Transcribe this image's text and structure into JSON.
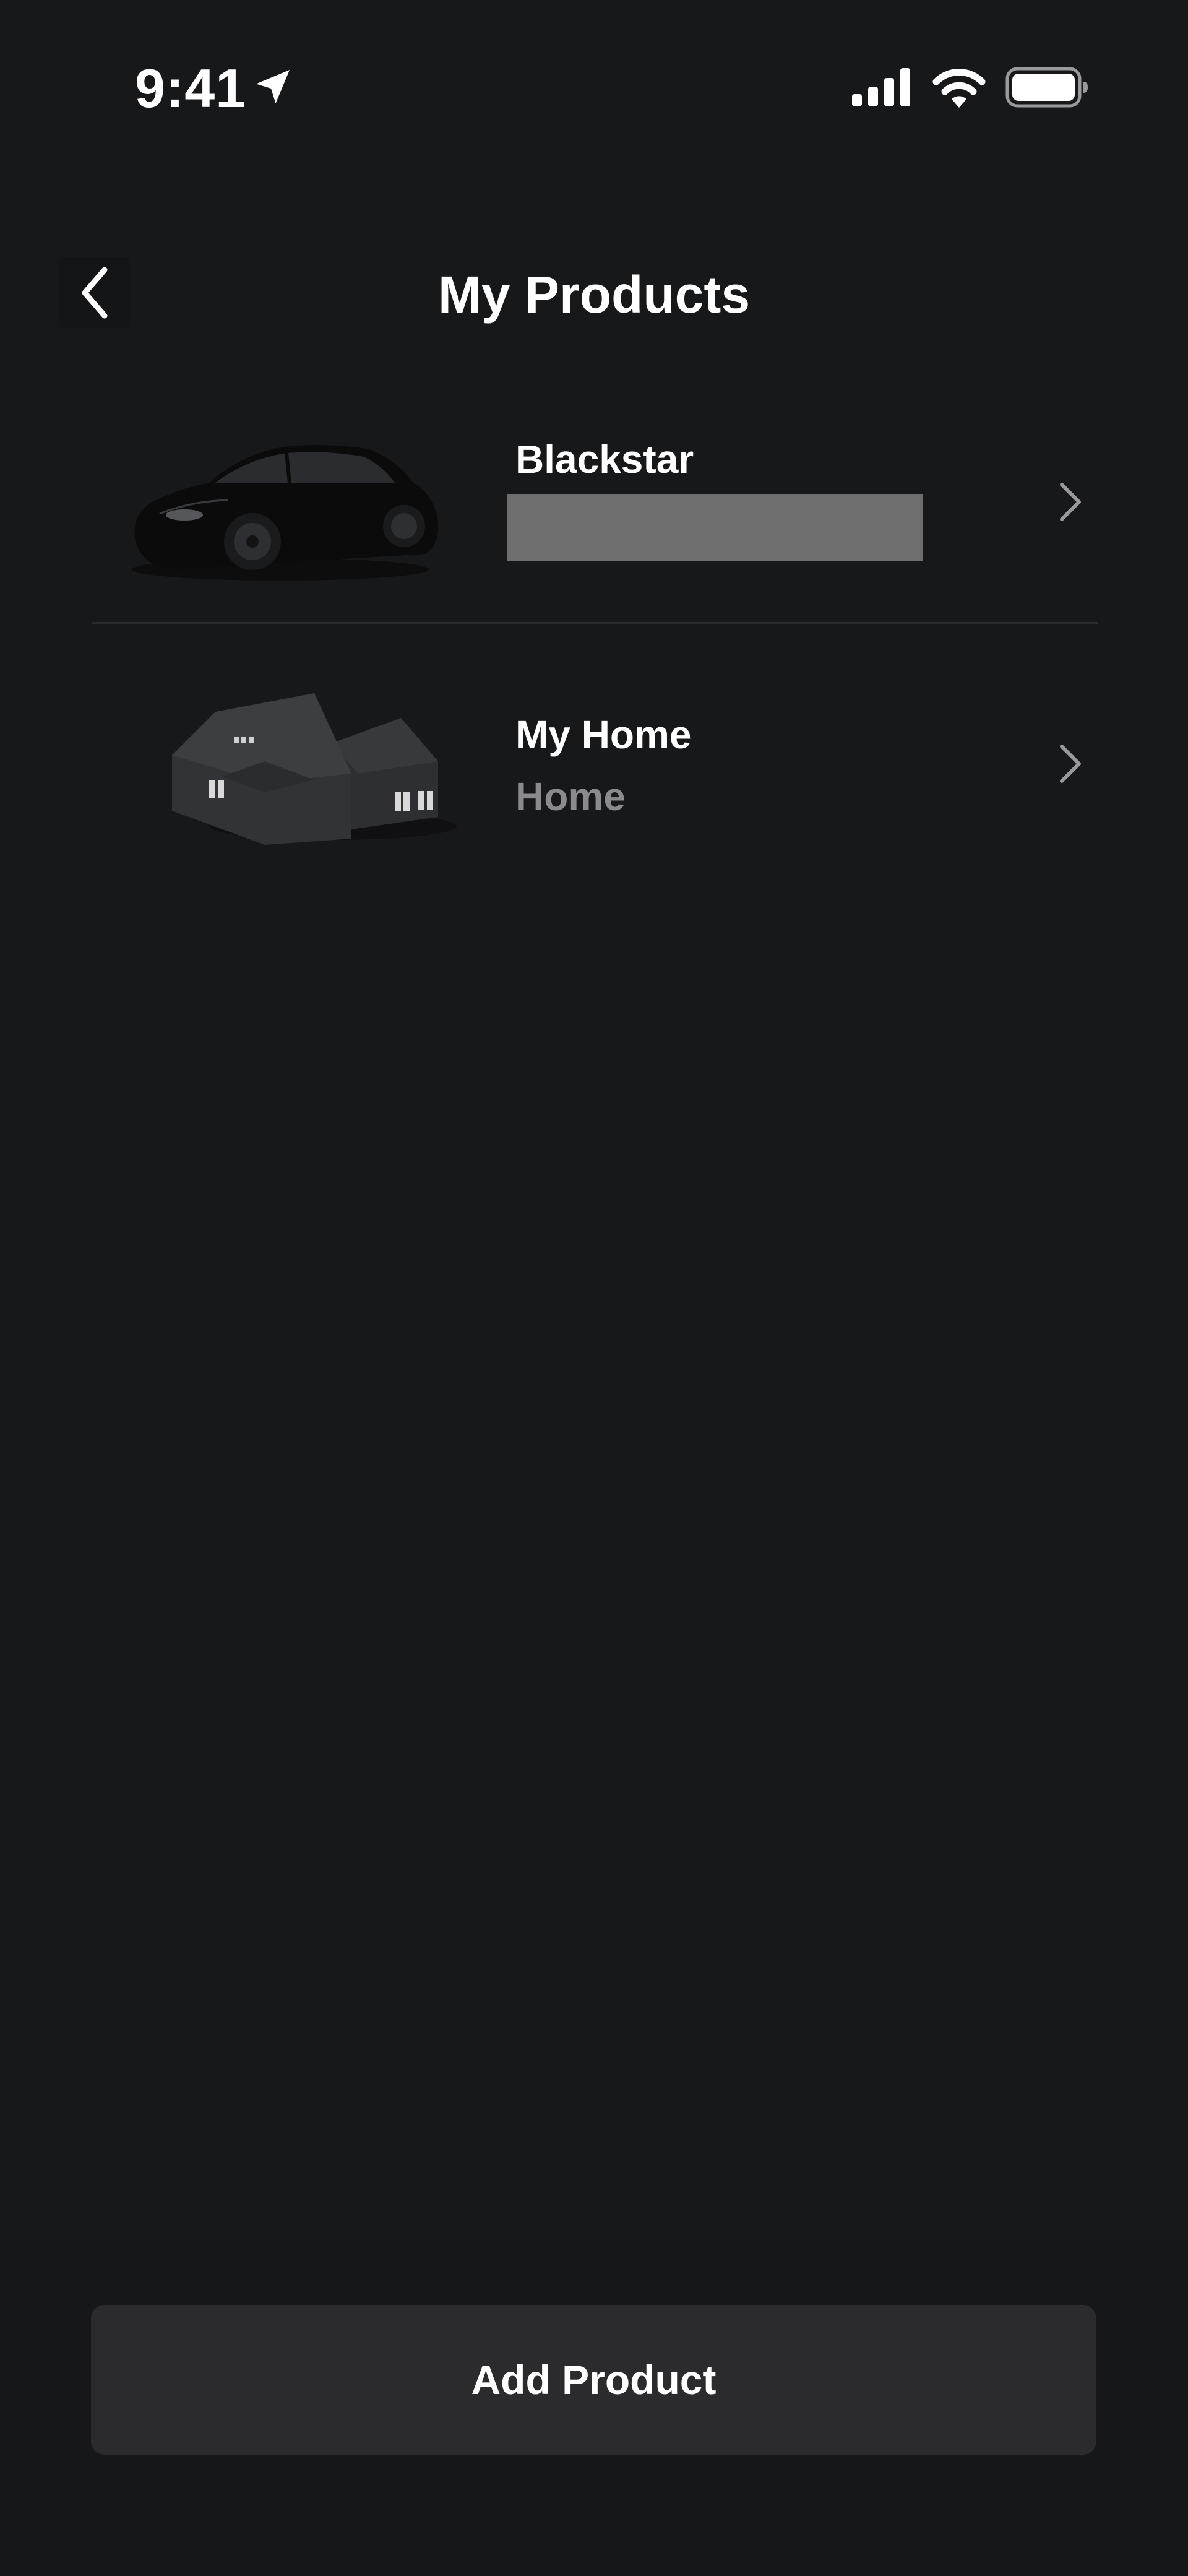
{
  "status_bar": {
    "time": "9:41",
    "icons": [
      "location-arrow-icon",
      "cellular-signal-icon",
      "wifi-icon",
      "battery-icon"
    ]
  },
  "header": {
    "title": "My Products",
    "back_icon": "chevron-left-icon"
  },
  "products": [
    {
      "name": "Blackstar",
      "subtitle": "",
      "subtitle_redacted": true,
      "image": "car-image",
      "chevron_icon": "chevron-right-icon"
    },
    {
      "name": "My Home",
      "subtitle": "Home",
      "subtitle_redacted": false,
      "image": "house-image",
      "chevron_icon": "chevron-right-icon"
    }
  ],
  "footer": {
    "add_button_label": "Add Product"
  },
  "colors": {
    "background": "#17181a",
    "text_primary": "#ffffff",
    "text_secondary": "#8b8b8d",
    "redacted": "#6e6e6e",
    "button_bg": "#2b2b2d",
    "divider": "#2a2b2e"
  }
}
